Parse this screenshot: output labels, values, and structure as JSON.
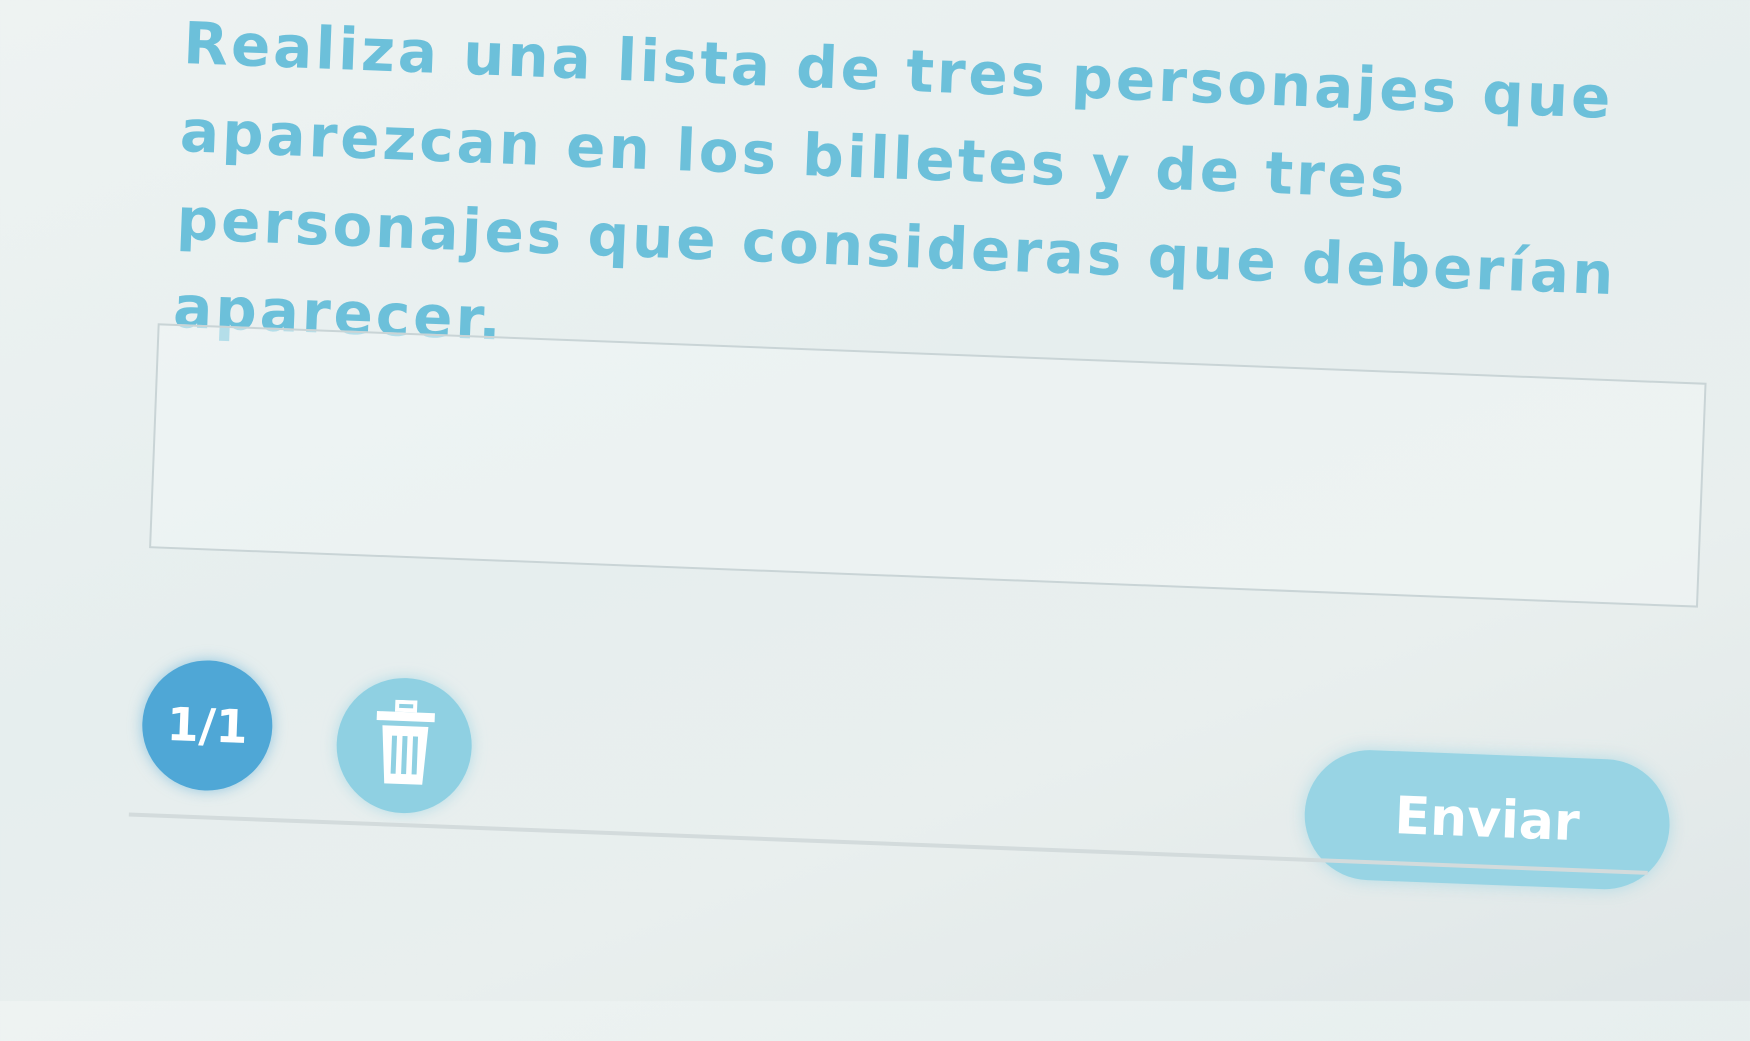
{
  "question": {
    "text": "Realiza una lista de tres personajes que aparezcan en los billetes y de tres personajes que consideras que deberían aparecer."
  },
  "answer": {
    "value": "",
    "placeholder": ""
  },
  "pagination": {
    "label": "1/1"
  },
  "actions": {
    "delete_icon": "trash-icon",
    "send_label": "Enviar"
  },
  "colors": {
    "question_text": "#6cc0da",
    "page_indicator": "#4fa7d6",
    "delete_button": "#8fd0e2",
    "send_button": "#98d4e4"
  }
}
